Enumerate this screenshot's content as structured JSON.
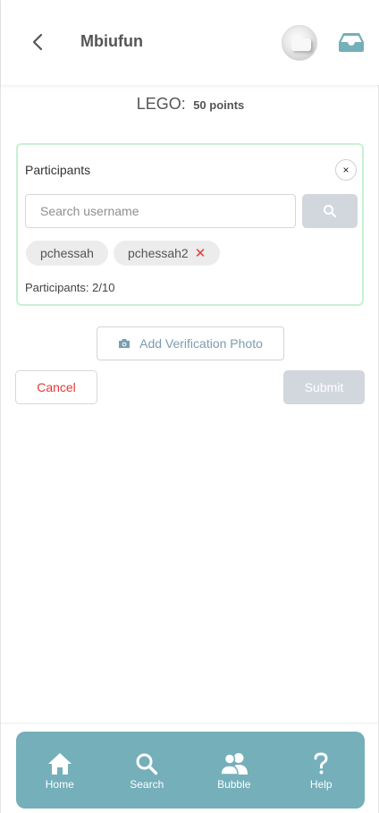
{
  "header": {
    "title": "Mbiufun",
    "back_icon": "chevron-left-icon",
    "inbox_icon": "inbox-tray-icon"
  },
  "item": {
    "name": "LEGO:",
    "points": "50 points"
  },
  "participants_card": {
    "title": "Participants",
    "close_label": "×",
    "search_placeholder": "Search username",
    "search_value": "",
    "chips": [
      {
        "username": "pchessah",
        "removable": false
      },
      {
        "username": "pchessah2",
        "removable": true
      }
    ],
    "remove_glyph": "✕",
    "count_label": "Participants: 2/10"
  },
  "verification": {
    "label": "Add Verification Photo",
    "icon": "camera-icon"
  },
  "actions": {
    "cancel_label": "Cancel",
    "submit_label": "Submit"
  },
  "bottom_nav": {
    "items": [
      {
        "label": "Home",
        "icon": "home-icon"
      },
      {
        "label": "Search",
        "icon": "search-icon"
      },
      {
        "label": "Bubble",
        "icon": "users-icon"
      },
      {
        "label": "Help",
        "icon": "question-icon"
      }
    ]
  },
  "colors": {
    "accent": "#74afba",
    "card_border": "#c7f1d2",
    "danger": "#e53935",
    "disabled_button": "#d2d6dd"
  }
}
